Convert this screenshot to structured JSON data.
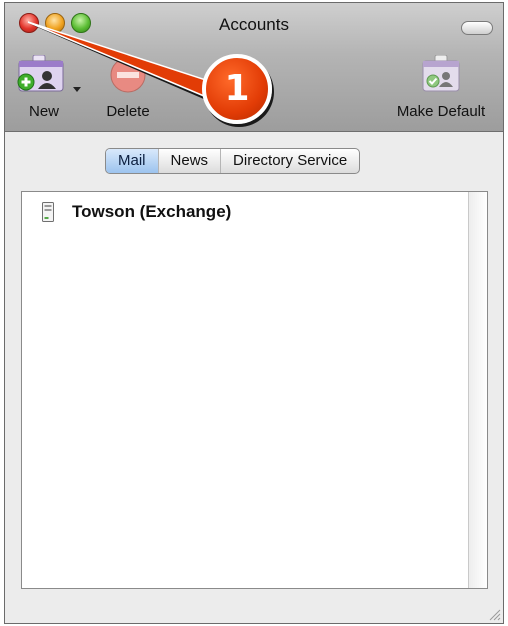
{
  "window": {
    "title": "Accounts"
  },
  "toolbar": {
    "new_label": "New",
    "delete_label": "Delete",
    "make_default_label": "Make Default"
  },
  "tabs": [
    {
      "label": "Mail",
      "selected": true
    },
    {
      "label": "News",
      "selected": false
    },
    {
      "label": "Directory Service",
      "selected": false
    }
  ],
  "accounts": [
    {
      "name": "Towson (Exchange)",
      "icon": "exchange-server-icon"
    }
  ],
  "callout": {
    "number": "1"
  },
  "colors": {
    "callout": "#e23c06",
    "tab_selected": "#9cc3ee"
  }
}
